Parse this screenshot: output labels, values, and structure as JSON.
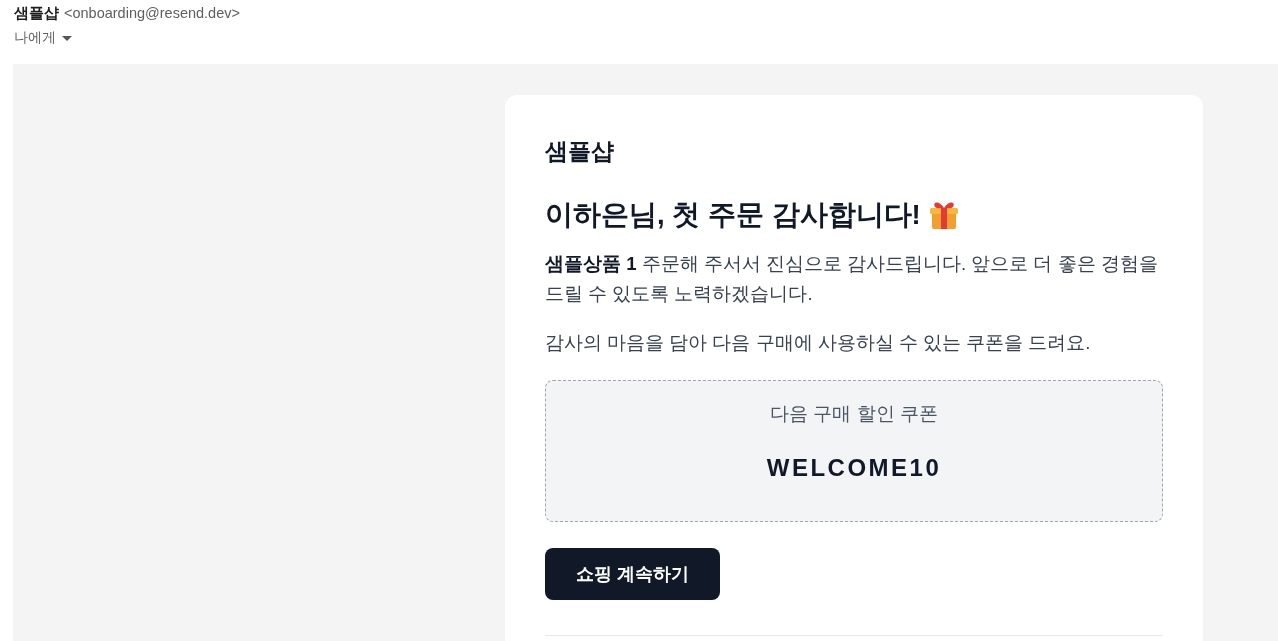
{
  "header": {
    "sender_name": "샘플샵",
    "sender_email": "<onboarding@resend.dev>",
    "recipient": "나에게"
  },
  "email": {
    "brand": "샘플샵",
    "heading": "이하은님, 첫 주문 감사합니다!",
    "paragraphs": [
      "**샘플상품 1** 주문해 주서서 진심으로 감사드립니다. 앞으로 더 좋은 경험을 드릴 수 있도록 노력하겠습니다.",
      "감사의 마음을 담아 다음 구매에 사용하실 수 있는 쿠폰을 드려요."
    ],
    "coupon": {
      "label": "다음 구매 할인 쿠폰",
      "code": "WELCOME10"
    },
    "button": "쇼핑 계속하기"
  }
}
